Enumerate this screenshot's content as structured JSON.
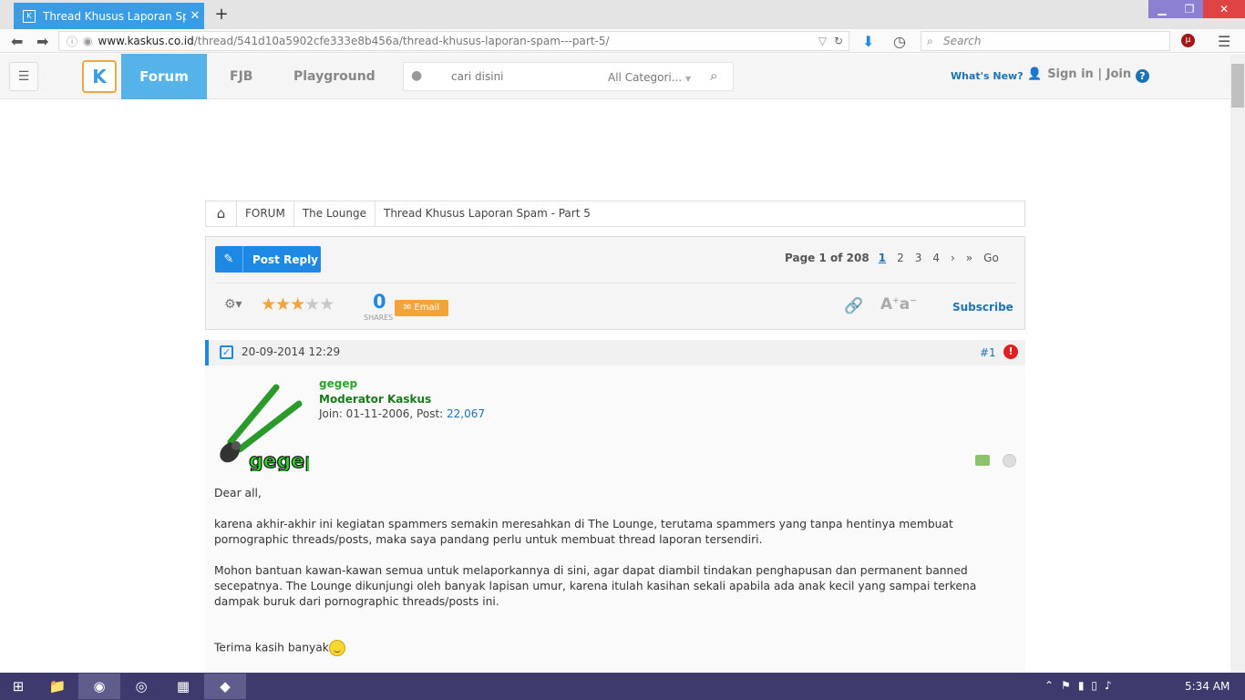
{
  "browser": {
    "tab_title": "Thread Khusus Laporan Sp...",
    "url_domain": "www.kaskus.co.id",
    "url_path": "/thread/541d10a5902cfe333e8b456a/thread-khusus-laporan-spam---part-5/",
    "search_placeholder": "Search"
  },
  "header": {
    "logo": "K",
    "nav": [
      "Forum",
      "FJB",
      "Playground"
    ],
    "search_placeholder": "cari disini",
    "category": "All Categori...",
    "whats_new": "What's New?",
    "signin": "Sign in | Join",
    "help": "?"
  },
  "breadcrumb": [
    "FORUM",
    "The Lounge",
    "Thread Khusus Laporan Spam - Part 5"
  ],
  "toolbar": {
    "post_reply": "Post Reply",
    "page_label": "Page 1 of 208",
    "pages": [
      "1",
      "2",
      "3",
      "4"
    ],
    "current_page": "1",
    "go": "Go",
    "rating": 3,
    "rating_max": 5,
    "shares_count": "0",
    "shares_label": "SHARES",
    "email": "Email",
    "subscribe": "Subscribe"
  },
  "post": {
    "date": "20-09-2014 12:29",
    "number": "#1",
    "username": "gegep",
    "role": "Moderator Kaskus",
    "join_label": "Join: 01-11-2006, Post: ",
    "post_count": "22,067",
    "avatar_text": "gegep",
    "paragraphs": [
      "Dear all,",
      "karena akhir-akhir ini kegiatan spammers semakin meresahkan di The Lounge, terutama spammers yang tanpa hentinya membuat pornographic threads/posts, maka saya pandang perlu untuk membuat thread laporan tersendiri.",
      "Mohon bantuan kawan-kawan semua untuk melaporkannya di sini, agar dapat diambil tindakan penghapusan dan permanent banned secepatnya. The Lounge dikunjungi oleh banyak lapisan umur, karena itulah kasihan sekali apabila ada anak kecil yang sampai terkena dampak buruk dari pornographic threads/posts ini."
    ],
    "closing": "Terima kasih banyak"
  },
  "taskbar": {
    "clock": "5:34 AM"
  },
  "colors": {
    "accent": "#1e88e5",
    "forum_tab": "#55b3ea",
    "email": "#f2a33a",
    "moderator": "#2aa52a"
  }
}
